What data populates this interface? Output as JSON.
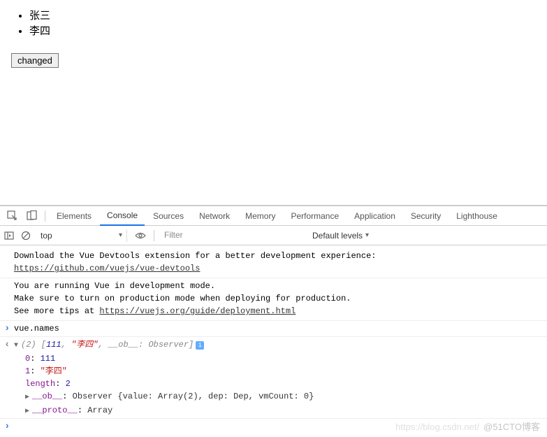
{
  "page": {
    "list": [
      "张三",
      "李四"
    ],
    "button_label": "changed"
  },
  "devtools": {
    "tabs": [
      "Elements",
      "Console",
      "Sources",
      "Network",
      "Memory",
      "Performance",
      "Application",
      "Security",
      "Lighthouse"
    ],
    "active_tab": "Console",
    "toolbar": {
      "context": "top",
      "filter_placeholder": "Filter",
      "levels_label": "Default levels"
    },
    "messages": {
      "devtools_line1": "Download the Vue Devtools extension for a better development experience:",
      "devtools_link": "https://github.com/vuejs/vue-devtools",
      "vue_line1": "You are running Vue in development mode.",
      "vue_line2": "Make sure to turn on production mode when deploying for production.",
      "vue_line3": "See more tips at ",
      "vue_link": "https://vuejs.org/guide/deployment.html"
    },
    "input": "vue.names",
    "output": {
      "summary_prefix": "(2)",
      "summary_items": "[111, \"李四\", __ob__: Observer]",
      "row0_key": "0",
      "row0_val": "111",
      "row1_key": "1",
      "row1_val": "\"李四\"",
      "length_key": "length",
      "length_val": "2",
      "ob_key": "__ob__",
      "ob_val": "Observer {value: Array(2), dep: Dep, vmCount: 0}",
      "proto_key": "__proto__",
      "proto_val": "Array"
    }
  },
  "watermark": "@51CTO博客"
}
